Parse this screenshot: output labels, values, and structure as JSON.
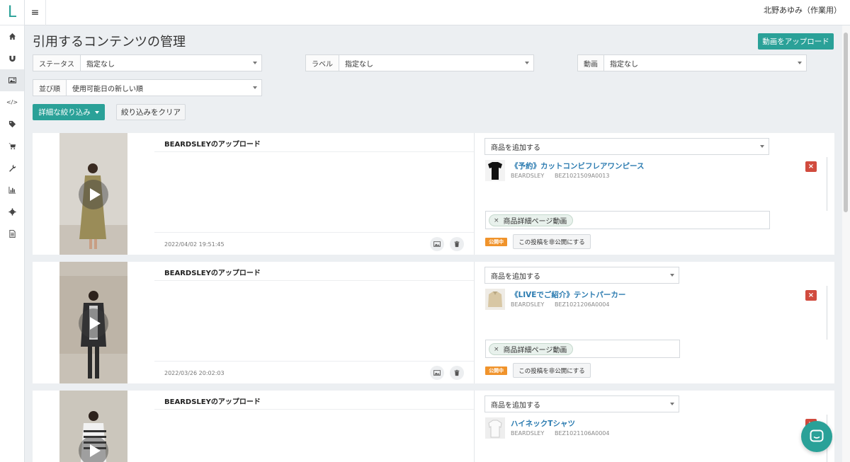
{
  "app": {
    "logo": "L",
    "user": "北野あゆみ（作業用）"
  },
  "sidebar": {
    "icons": [
      {
        "name": "home-icon",
        "glyph": "⌂"
      },
      {
        "name": "magnet-icon",
        "glyph": "U"
      },
      {
        "name": "image-icon",
        "glyph": ""
      },
      {
        "name": "code-icon",
        "glyph": "</>"
      },
      {
        "name": "tag-icon",
        "glyph": ""
      },
      {
        "name": "cart-icon",
        "glyph": ""
      },
      {
        "name": "wrench-icon",
        "glyph": ""
      },
      {
        "name": "chart-icon",
        "glyph": ""
      },
      {
        "name": "gear-icon",
        "glyph": ""
      },
      {
        "name": "document-icon",
        "glyph": ""
      }
    ]
  },
  "page": {
    "title": "引用するコンテンツの管理",
    "upload_label": "動画をアップロード"
  },
  "filters": {
    "status": {
      "label": "ステータス",
      "value": "指定なし"
    },
    "label": {
      "label": "ラベル",
      "value": "指定なし"
    },
    "video": {
      "label": "動画",
      "value": "指定なし"
    },
    "sort": {
      "label": "並び順",
      "value": "使用可能日の新しい順"
    },
    "advanced_label": "詳細な絞り込み",
    "clear_label": "絞り込みをクリア"
  },
  "cards": [
    {
      "title": "BEARDSLEYのアップロード",
      "date": "2022/04/02 19:51:45",
      "add_product": "商品を追加する",
      "product": {
        "name": "《予約》カットコンビフレアワンピース",
        "brand": "BEARDSLEY",
        "code": "BEZ1021509A0013"
      },
      "tag": "商品詳細ページ動画",
      "tag_remove": "×",
      "status": "公開中",
      "unpublish_label": "この投稿を非公開にする",
      "delete_glyph": "×"
    },
    {
      "title": "BEARDSLEYのアップロード",
      "date": "2022/03/26 20:02:03",
      "add_product": "商品を追加する",
      "product": {
        "name": "《LIVEでご紹介》テントパーカー",
        "brand": "BEARDSLEY",
        "code": "BEZ1021206A0004"
      },
      "tag": "商品詳細ページ動画",
      "tag_remove": "×",
      "status": "公開中",
      "unpublish_label": "この投稿を非公開にする",
      "delete_glyph": "×"
    },
    {
      "title": "BEARDSLEYのアップロード",
      "add_product": "商品を追加する",
      "product": {
        "name": "ハイネックTシャツ",
        "brand": "BEARDSLEY",
        "code": "BEZ1021106A0004"
      },
      "delete_glyph": "×"
    }
  ]
}
